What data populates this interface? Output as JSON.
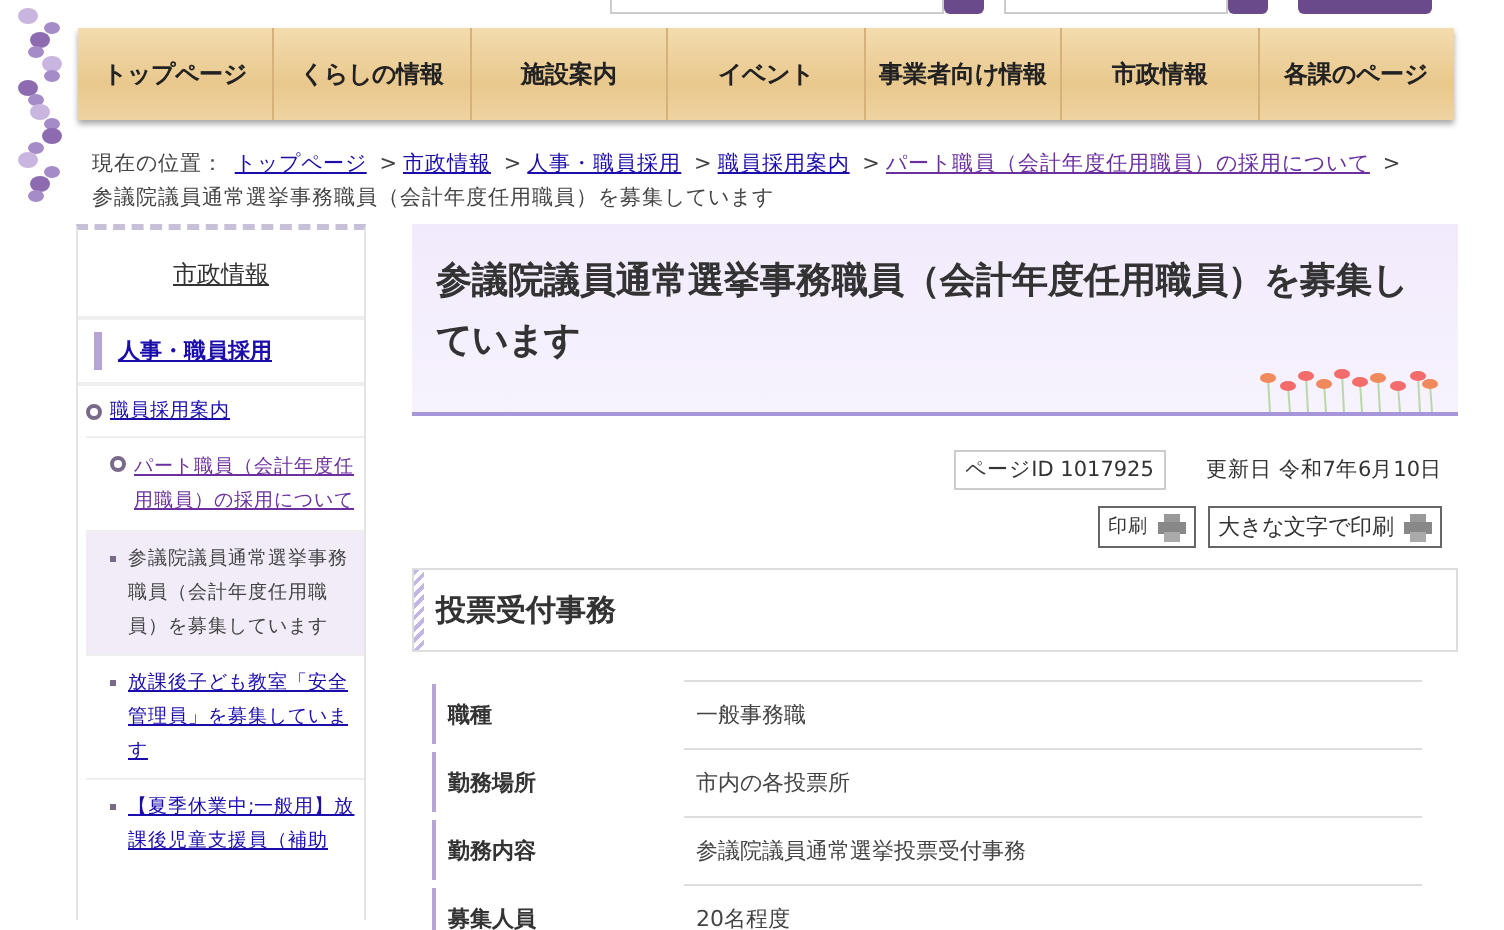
{
  "nav": [
    {
      "label": "トップページ"
    },
    {
      "label": "くらしの情報"
    },
    {
      "label": "施設案内"
    },
    {
      "label": "イベント"
    },
    {
      "label": "事業者向け情報"
    },
    {
      "label": "市政情報"
    },
    {
      "label": "各課のページ"
    }
  ],
  "breadcrumb": {
    "prefix": "現在の位置：",
    "links": [
      {
        "label": "トップページ",
        "visited": false
      },
      {
        "label": "市政情報",
        "visited": false
      },
      {
        "label": "人事・職員採用",
        "visited": false
      },
      {
        "label": "職員採用案内",
        "visited": false
      },
      {
        "label": "パート職員（会計年度任用職員）の採用について",
        "visited": true
      }
    ],
    "separator": ">",
    "current": "参議院議員通常選挙事務職員（会計年度任用職員）を募集しています"
  },
  "sidebar": {
    "title": "市政情報",
    "section": "人事・職員採用",
    "items": [
      {
        "label": "職員採用案内",
        "visited": false,
        "children": [
          {
            "label": "パート職員（会計年度任用職員）の採用について",
            "visited": true,
            "children": [
              {
                "label": "参議院議員通常選挙事務職員（会計年度任用職員）を募集しています",
                "visited": false,
                "selected": true
              },
              {
                "label": "放課後子ども教室「安全管理員」を募集しています",
                "visited": false,
                "selected": false
              },
              {
                "label": "【夏季休業中;一般用】放課後児童支援員（補助",
                "visited": false,
                "selected": false
              }
            ]
          }
        ]
      }
    ]
  },
  "page": {
    "title": "参議院議員通常選挙事務職員（会計年度任用職員）を募集しています",
    "page_id": "ページID 1017925",
    "updated": "更新日 令和7年6月10日",
    "print_buttons": [
      {
        "label": "印刷"
      },
      {
        "label": "大きな文字で印刷"
      }
    ],
    "section_title": "投票受付事務",
    "table": [
      {
        "label": "職種",
        "value": "一般事務職"
      },
      {
        "label": "勤務場所",
        "value": "市内の各投票所"
      },
      {
        "label": "勤務内容",
        "value": "参議院議員通常選挙投票受付事務"
      },
      {
        "label": "募集人員",
        "value": "20名程度"
      }
    ]
  }
}
